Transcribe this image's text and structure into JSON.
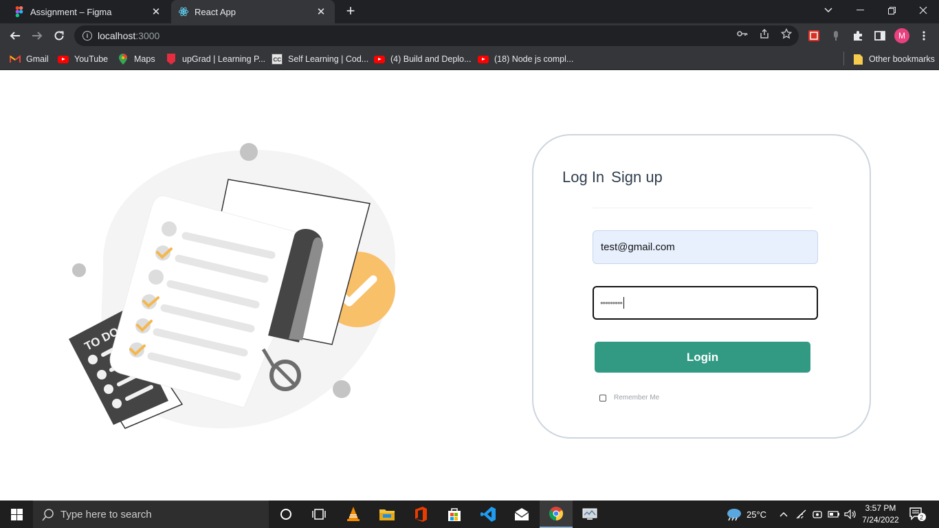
{
  "browser": {
    "tabs": [
      {
        "title": "Assignment – Figma",
        "active": false,
        "icon": "figma-icon"
      },
      {
        "title": "React App",
        "active": true,
        "icon": "react-icon"
      }
    ],
    "address": {
      "host": "localhost",
      "port": ":3000"
    },
    "bookmarks": [
      {
        "label": "Gmail",
        "icon": "gmail-icon"
      },
      {
        "label": "YouTube",
        "icon": "youtube-icon"
      },
      {
        "label": "Maps",
        "icon": "maps-icon"
      },
      {
        "label": "upGrad | Learning P...",
        "icon": "upgrad-icon"
      },
      {
        "label": "Self Learning | Cod...",
        "icon": "codingclub-icon"
      },
      {
        "label": "(4) Build and Deplo...",
        "icon": "youtube-icon"
      },
      {
        "label": "(18) Node js compl...",
        "icon": "youtube-icon"
      }
    ],
    "other_bookmarks": "Other bookmarks",
    "profile_initial": "M"
  },
  "illustration": {
    "todo_text": "TO DO"
  },
  "auth": {
    "tab_login": "Log In",
    "tab_signup": "Sign up",
    "email_value": "test@gmail.com",
    "password_mask": "•••••••••",
    "login_button": "Login",
    "remember_me": "Remember Me"
  },
  "taskbar": {
    "search_placeholder": "Type here to search",
    "temperature": "25°C",
    "time": "3:57 PM",
    "date": "7/24/2022",
    "notifications": "2"
  },
  "colors": {
    "accent_button": "#329a83",
    "check_circle": "#f9c06a",
    "card_border": "#cdd5dc"
  }
}
